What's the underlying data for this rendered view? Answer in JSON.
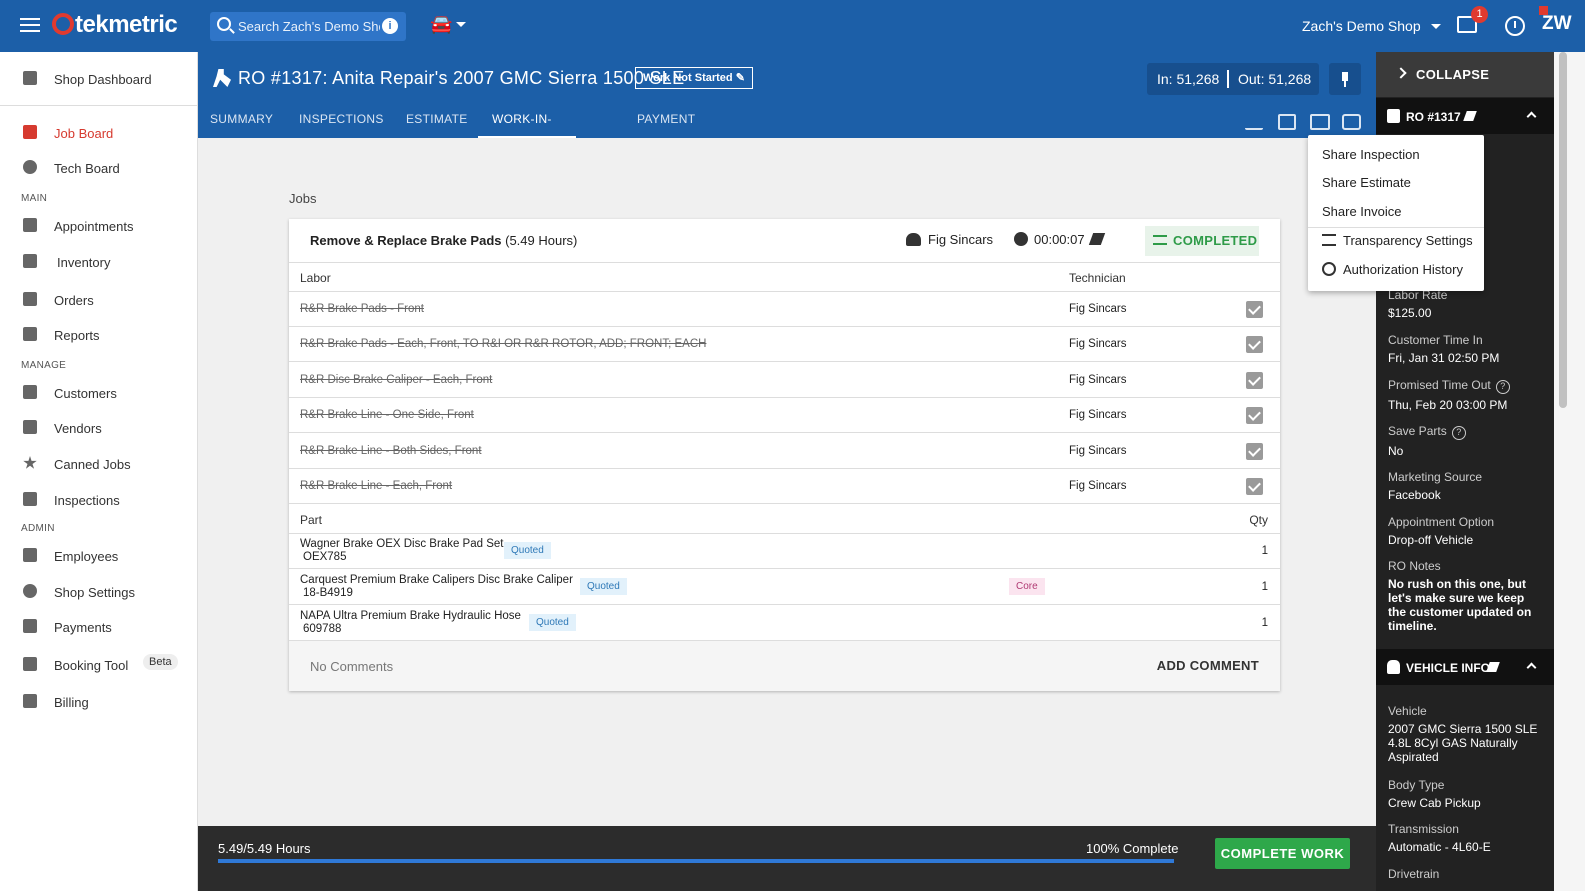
{
  "app": {
    "logo": "tekmetric"
  },
  "topbar": {
    "search_placeholder": "Search Zach's Demo Shop",
    "shop_name": "Zach's Demo Shop",
    "notification_count": "1",
    "user_initials": "ZW"
  },
  "sidebar": {
    "dashboard": "Shop Dashboard",
    "job_board": "Job Board",
    "tech_board": "Tech Board",
    "main_label": "MAIN",
    "appointments": "Appointments",
    "inventory": "Inventory",
    "orders": "Orders",
    "reports": "Reports",
    "manage_label": "MANAGE",
    "customers": "Customers",
    "vendors": "Vendors",
    "canned_jobs": "Canned Jobs",
    "inspections": "Inspections",
    "admin_label": "ADMIN",
    "employees": "Employees",
    "shop_settings": "Shop Settings",
    "payments": "Payments",
    "booking_tool": "Booking Tool",
    "beta": "Beta",
    "billing": "Billing"
  },
  "header": {
    "ro_title": "RO #1317: Anita Repair's 2007 GMC Sierra 1500 SLE",
    "status": "Work Not Started",
    "mileage_in": "In: 51,268",
    "mileage_out": "Out: 51,268",
    "tabs": [
      "SUMMARY",
      "INSPECTIONS",
      "ESTIMATE",
      "WORK-IN-PROGRESS",
      "PAYMENT"
    ]
  },
  "jobs": {
    "label": "Jobs",
    "title": "Remove & Replace Brake Pads",
    "hours": "(5.49 Hours)",
    "technician": "Fig Sincars",
    "timer": "00:00:07",
    "status": "COMPLETED",
    "labor_header": "Labor",
    "tech_header": "Technician",
    "labor": [
      {
        "desc": "R&R Brake Pads - Front",
        "tech": "Fig Sincars"
      },
      {
        "desc": "R&R Brake Pads - Each, Front, TO R&I OR R&R ROTOR, ADD; FRONT; EACH",
        "tech": "Fig Sincars"
      },
      {
        "desc": "R&R Disc Brake Caliper - Each, Front",
        "tech": "Fig Sincars"
      },
      {
        "desc": "R&R Brake Line - One Side, Front",
        "tech": "Fig Sincars"
      },
      {
        "desc": "R&R Brake Line - Both Sides, Front",
        "tech": "Fig Sincars"
      },
      {
        "desc": "R&R Brake Line - Each, Front",
        "tech": "Fig Sincars"
      }
    ],
    "part_header": "Part",
    "qty_header": "Qty",
    "parts": [
      {
        "name": "Wagner Brake OEX Disc Brake Pad Set",
        "number": "OEX785",
        "tag": "Quoted",
        "qty": "1"
      },
      {
        "name": "Carquest Premium Brake Calipers Disc Brake Caliper",
        "number": "18-B4919",
        "tag": "Quoted",
        "core": "Core",
        "qty": "1"
      },
      {
        "name": "NAPA Ultra Premium Brake Hydraulic Hose",
        "number": "609788",
        "tag": "Quoted",
        "qty": "1"
      }
    ],
    "no_comments": "No Comments",
    "add_comment": "ADD COMMENT"
  },
  "share_menu": [
    "Share Inspection",
    "Share Estimate",
    "Share Invoice",
    "Transparency Settings",
    "Authorization History"
  ],
  "right_panel": {
    "collapse": "COLLAPSE",
    "ro_section": "RO #1317",
    "fields": [
      {
        "label": "Labor Rate",
        "value": "$125.00"
      },
      {
        "label": "Customer Time In",
        "value": "Fri, Jan 31 02:50 PM"
      },
      {
        "label": "Promised Time Out",
        "value": "Thu, Feb 20 03:00 PM"
      },
      {
        "label": "Save Parts",
        "value": "No"
      },
      {
        "label": "Marketing Source",
        "value": "Facebook"
      },
      {
        "label": "Appointment Option",
        "value": "Drop-off Vehicle"
      },
      {
        "label": "RO Notes",
        "value": "No rush on this one, but let's make sure we keep the customer updated on timeline."
      }
    ],
    "vehicle_section": "VEHICLE INFO",
    "vehicle_fields": [
      {
        "label": "Vehicle",
        "value": "2007 GMC Sierra 1500 SLE 4.8L 8Cyl GAS Naturally Aspirated"
      },
      {
        "label": "Body Type",
        "value": "Crew Cab Pickup"
      },
      {
        "label": "Transmission",
        "value": "Automatic - 4L60-E"
      },
      {
        "label": "Drivetrain",
        "value": ""
      }
    ]
  },
  "bottom": {
    "hours": "5.49/5.49 Hours",
    "complete_pct": "100% Complete",
    "progress": 1.0,
    "complete_button": "COMPLETE WORK"
  },
  "colors": {
    "brand_blue": "#1c5fa8",
    "complete_green": "#2ea84a",
    "accent_red": "#d63a2f"
  }
}
